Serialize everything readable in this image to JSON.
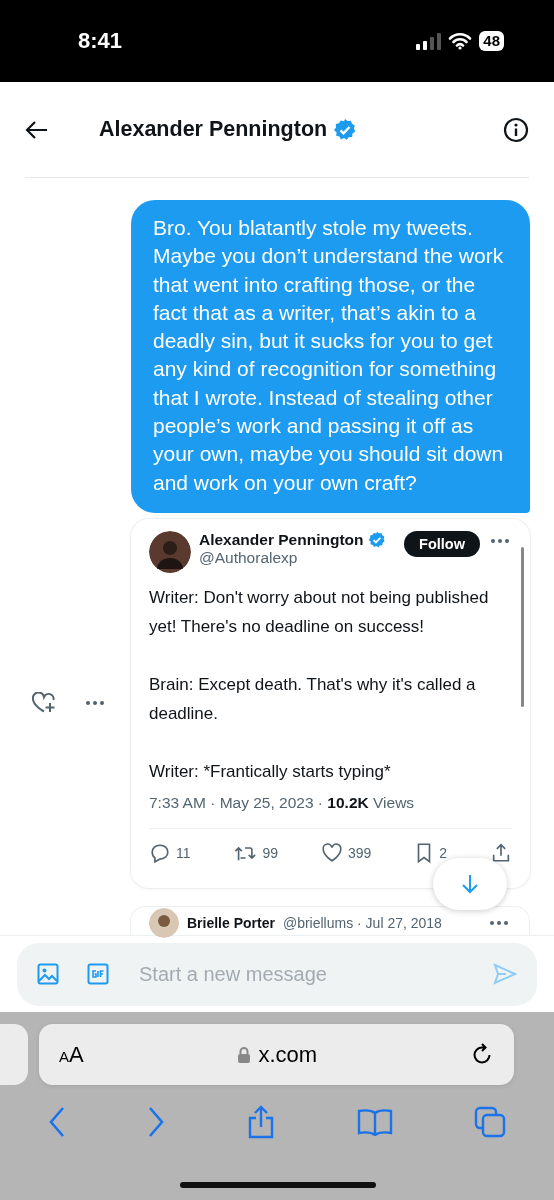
{
  "status_bar": {
    "time": "8:41",
    "battery": "48"
  },
  "header": {
    "title": "Alexander Pennington",
    "verified": true
  },
  "bubble": {
    "text": "Bro. You blatantly stole my tweets. Maybe you don’t understand the work that went into crafting those, or the fact that as a writer, that’s akin to a deadly sin, but it sucks for you to get any kind of recognition for something that I wrote. Instead of stealing other people’s work and passing it off as your own, maybe you should sit down and work on your own craft?"
  },
  "shared_tweet": {
    "author": "Alexander Pennington",
    "verified": true,
    "handle": "@Authoralexp",
    "follow_label": "Follow",
    "paragraphs": [
      "Writer: Don't worry about not being published yet! There's no deadline on success!",
      "Brain: Except death. That's why it's called a deadline.",
      "Writer: *Frantically starts typing*"
    ],
    "meta": "7:33 AM · May 25, 2023 · **10.2K** Views",
    "actions": [
      {
        "kind": "reply",
        "count": "11"
      },
      {
        "kind": "repost",
        "count": "99"
      },
      {
        "kind": "like",
        "count": "399"
      },
      {
        "kind": "bookmark",
        "count": "2"
      },
      {
        "kind": "share"
      }
    ]
  },
  "next_tweet": {
    "author": "Brielle Porter",
    "handle_date": "@briellums · Jul 27, 2018"
  },
  "composer": {
    "placeholder": "Start a new message"
  },
  "browser": {
    "text_size": "AA",
    "url": "x.com"
  }
}
